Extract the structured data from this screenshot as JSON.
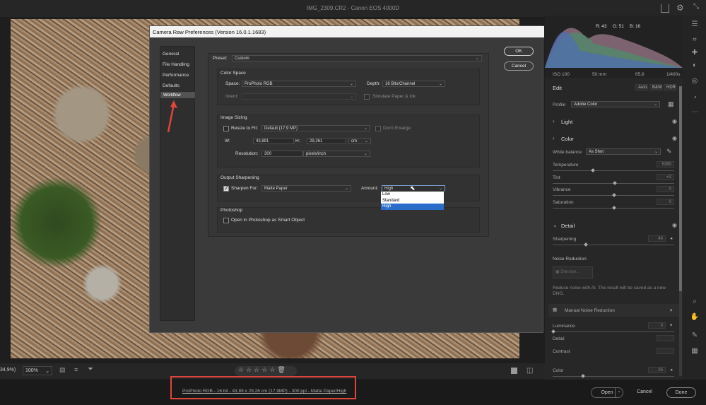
{
  "window": {
    "title": "IMG_2309.CR2  -  Canon EOS 4000D"
  },
  "dialog": {
    "title": "Camera Raw Preferences  (Version 16.0.1.1683)",
    "nav": [
      "General",
      "File Handling",
      "Performance",
      "Defaults",
      "Workflow"
    ],
    "ok": "OK",
    "cancel": "Cancel",
    "preset_label": "Preset:",
    "preset_value": "Custom",
    "color_space": {
      "title": "Color Space",
      "space_label": "Space:",
      "space_value": "ProPhoto RGB",
      "depth_label": "Depth:",
      "depth_value": "16 Bits/Channel",
      "intent_label": "Intent:",
      "simulate": "Simulate Paper & Ink"
    },
    "image_sizing": {
      "title": "Image Sizing",
      "resize_label": "Resize to Fit:",
      "resize_value": "Default  (17,9 MP)",
      "dont_enlarge": "Don't Enlarge",
      "w_label": "W:",
      "w_value": "43,891",
      "h_label": "H:",
      "h_value": "29,261",
      "unit": "cm",
      "res_label": "Resolution:",
      "res_value": "300",
      "res_unit": "pixels/inch"
    },
    "output_sharpening": {
      "title": "Output Sharpening",
      "sharpen_label": "Sharpen For:",
      "sharpen_value": "Matte Paper",
      "amount_label": "Amount:",
      "amount_value": "High",
      "options": [
        "Low",
        "Standard",
        "High"
      ]
    },
    "photoshop": {
      "title": "Photoshop",
      "smart_object": "Open in Photoshop as Smart Object"
    }
  },
  "histogram": {
    "r": "R: 43",
    "g": "G: 51",
    "b": "B: 16",
    "iso": "ISO 100",
    "focal": "50 mm",
    "aperture": "f/5,6",
    "shutter": "1/400s"
  },
  "edit": {
    "title": "Edit",
    "auto": "Auto",
    "bw": "B&W",
    "hdr": "HDR",
    "profile_label": "Profile",
    "profile_value": "Adobe Color"
  },
  "light": {
    "title": "Light"
  },
  "color": {
    "title": "Color",
    "wb_label": "White balance",
    "wb_value": "As Shot",
    "temp_label": "Temperature",
    "temp_value": "5350",
    "tint_label": "Tint",
    "tint_value": "+2",
    "vib_label": "Vibrance",
    "vib_value": "0",
    "sat_label": "Saturation",
    "sat_value": "0"
  },
  "detail": {
    "title": "Detail",
    "sharp_label": "Sharpening",
    "sharp_value": "40",
    "nr_label": "Noise Reduction",
    "denoise": "Denoise...",
    "nr_desc": "Reduce noise with AI. The result will be saved as a new DNG.",
    "mnr": "Manual Noise Reduction",
    "lum_label": "Luminance",
    "lum_value": "0",
    "det_label": "Detail",
    "con_label": "Contrast",
    "col_label": "Color",
    "col_value": "25"
  },
  "toolbar": {
    "zoom1": "34,9%)",
    "zoom2": "100%"
  },
  "footer": {
    "workflow_link": "ProPhoto RGB - 16 bit - 43,89 x 29,26 cm (17,9MP) - 300 ppi - Matte Paper/High",
    "open": "Open",
    "cancel": "Cancel",
    "done": "Done"
  },
  "colors": {
    "accent": "#2a6cc8",
    "annotation": "#e0443a"
  }
}
